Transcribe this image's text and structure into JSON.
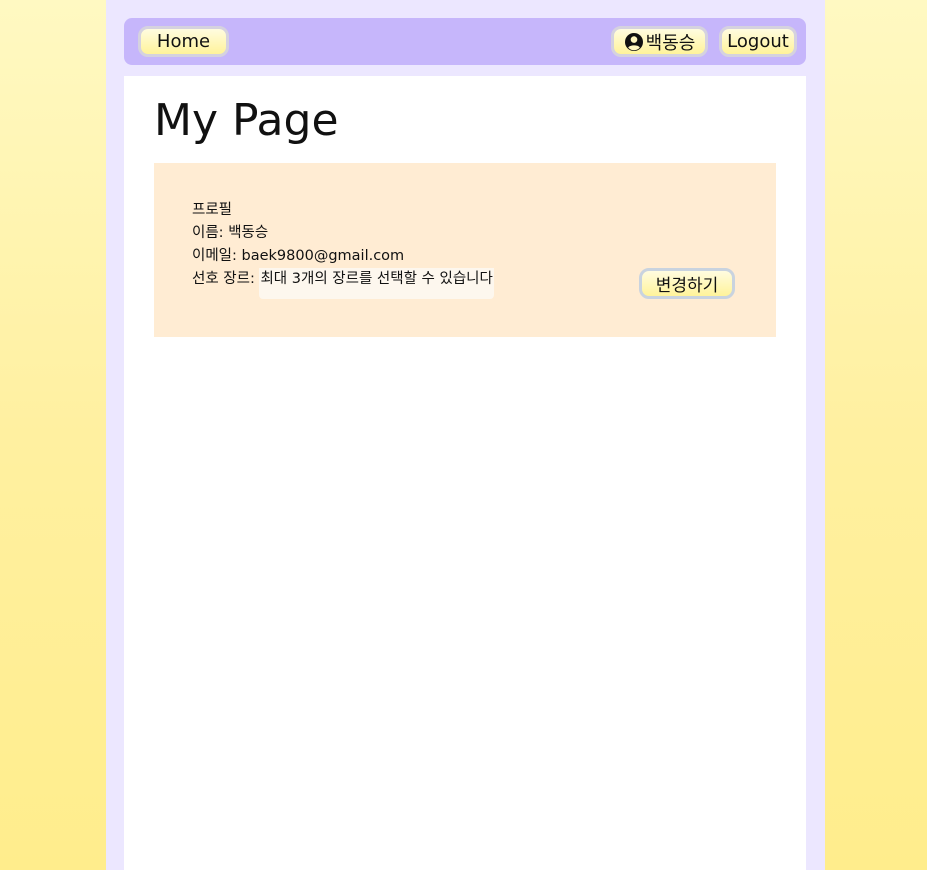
{
  "nav": {
    "home_label": "Home",
    "user_name": "백동승",
    "logout_label": "Logout"
  },
  "page": {
    "title": "My Page"
  },
  "profile": {
    "heading": "프로필",
    "name_label": "이름: ",
    "name_value": "백동승",
    "email_label": "이메일: ",
    "email_value": "baek9800@gmail.com",
    "genre_label": "선호 장르: ",
    "genre_note": "최대 3개의 장르를 선택할 수 있습니다",
    "edit_label": "변경하기"
  },
  "colors": {
    "background": "#fff0a0",
    "frame": "#ece7ff",
    "navbar": "#c6b6fb",
    "profile_card": "#ffecd3",
    "button_yellow": "#fff39a"
  },
  "icons": {
    "user": "user-circle-icon"
  }
}
